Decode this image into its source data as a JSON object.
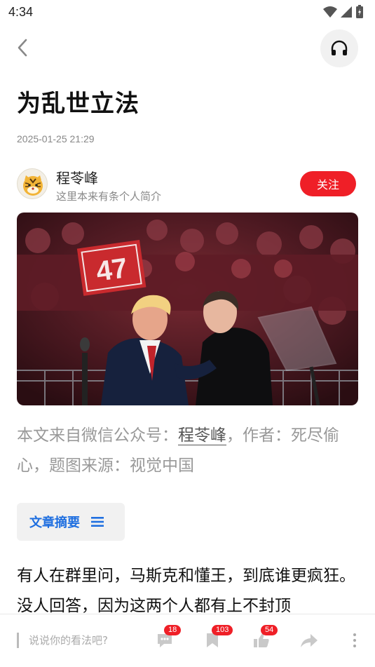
{
  "status_bar": {
    "time": "4:34"
  },
  "article": {
    "title": "为乱世立法",
    "date": "2025-01-25 21:29"
  },
  "author": {
    "name": "程苓峰",
    "bio": "这里本来有条个人简介",
    "follow_label": "关注"
  },
  "source": {
    "prefix": "本文来自微信公众号：",
    "account": "程苓峰",
    "suffix": "，作者：死尽偷心，题图来源：视觉中国"
  },
  "summary": {
    "label": "文章摘要"
  },
  "body": {
    "text": "有人在群里问，马斯克和懂王，到底谁更疯狂。没人回答，因为这两个人都有上不封顶"
  },
  "bottom_bar": {
    "comment_placeholder": "说说你的看法吧?",
    "comment_count": "18",
    "bookmark_count": "103",
    "like_count": "54"
  },
  "image": {
    "sign_text": "47"
  },
  "colors": {
    "accent_red": "#ef1f27",
    "link_blue": "#1f6fe0"
  }
}
